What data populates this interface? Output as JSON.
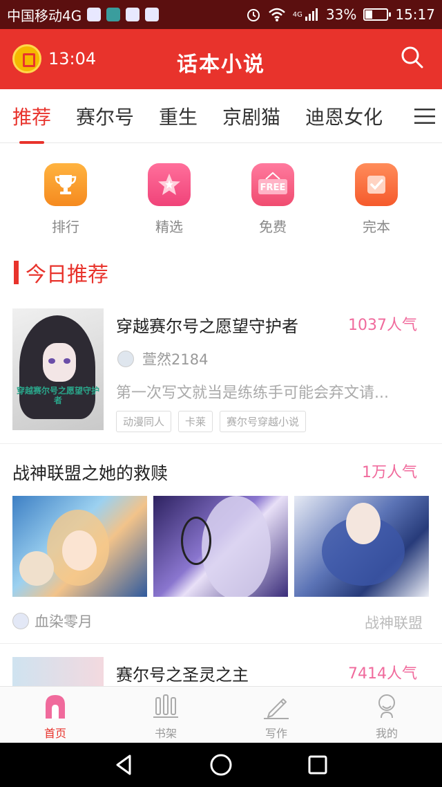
{
  "status_bar": {
    "carrier": "中国移动4G",
    "network_type": "4G",
    "battery": "33%",
    "time": "15:17",
    "icons": [
      "baidu-paw-icon",
      "shield-icon",
      "baidu-paw-icon",
      "baidu-paw-icon",
      "alarm-clock-icon",
      "wifi-icon",
      "signal-icon",
      "battery-icon"
    ]
  },
  "header": {
    "timer": "13:04",
    "title": "话本小说",
    "icons": [
      "alarm-timer-icon",
      "search-icon"
    ]
  },
  "tabs": [
    {
      "label": "推荐",
      "active": true
    },
    {
      "label": "赛尔号",
      "active": false
    },
    {
      "label": "重生",
      "active": false
    },
    {
      "label": "京剧猫",
      "active": false
    },
    {
      "label": "迪恩女化",
      "active": false
    }
  ],
  "quick_entries": [
    {
      "label": "排行",
      "icon": "trophy-icon"
    },
    {
      "label": "精选",
      "icon": "star-icon"
    },
    {
      "label": "免费",
      "icon": "free-sign-icon",
      "icon_text": "FREE"
    },
    {
      "label": "完本",
      "icon": "check-note-icon"
    }
  ],
  "section": {
    "title": "今日推荐"
  },
  "books": [
    {
      "title": "穿越赛尔号之愿望守护者",
      "popularity": "1037人气",
      "author": "萱然2184",
      "description": "第一次写文就当是练练手可能会弃文请...",
      "tags": [
        "动漫同人",
        "卡莱",
        "赛尔号穿越小说"
      ],
      "cover_text": "穿越赛尔号之愿望守护者"
    },
    {
      "title": "战神联盟之她的救赎",
      "popularity": "1万人气",
      "author": "血染零月",
      "category": "战神联盟"
    },
    {
      "title": "赛尔号之圣灵之主",
      "popularity": "7414人气"
    }
  ],
  "bottom_nav": [
    {
      "label": "首页",
      "icon": "home-icon",
      "active": true
    },
    {
      "label": "书架",
      "icon": "bookshelf-icon",
      "active": false
    },
    {
      "label": "写作",
      "icon": "pen-icon",
      "active": false
    },
    {
      "label": "我的",
      "icon": "profile-icon",
      "active": false
    }
  ],
  "colors": {
    "brand_red": "#e8332c",
    "popularity_pink": "#f06a9c",
    "status_bar": "#5b0f0f"
  }
}
